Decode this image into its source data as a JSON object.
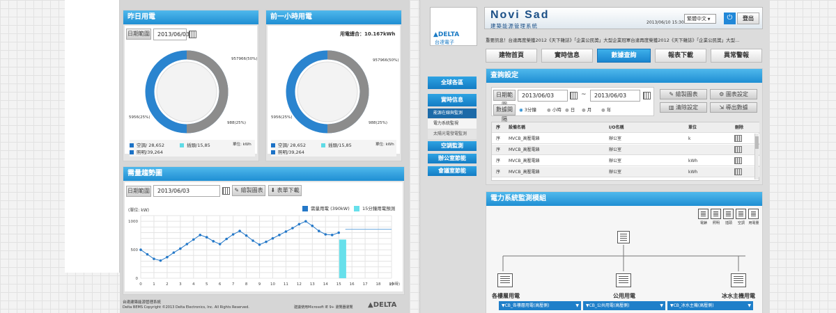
{
  "left": {
    "yesterday": {
      "title": "昨日用電",
      "date_label": "日期範圍",
      "date_value": "2013/06/03",
      "labels": {
        "top": "957966(50%)",
        "right": "988(25%)",
        "left": "5956(25%)"
      },
      "legend": [
        {
          "text": "空調/ 28,652",
          "color": "#1c72c6"
        },
        {
          "text": "插頭/15,85",
          "color": "#5fdbe6"
        },
        {
          "text": "照明/39,264",
          "color": "#1c72c6"
        }
      ],
      "unit": "單位: kWh"
    },
    "last_hour": {
      "title": "前一小時用電",
      "total": "用電總合：10.167kWh",
      "labels": {
        "top": "957966(50%)",
        "right": "988(25%)",
        "left": "5956(25%)"
      },
      "legend": [
        {
          "text": "空調/ 28,652",
          "color": "#1c72c6"
        },
        {
          "text": "插頭/15,85",
          "color": "#5fdbe6"
        },
        {
          "text": "照明/39,264",
          "color": "#1c72c6"
        }
      ],
      "unit": "單位: kWh"
    },
    "trend": {
      "title": "需量趨勢圖",
      "date_label": "日期範圍",
      "date_value": "2013/06/03",
      "draw_btn": "繪製圖表",
      "export_btn": "表單下載",
      "ylabel": "(單位: kW)",
      "legend1": "需量用電 (390kW)",
      "legend2": "15分鐘用電預測"
    },
    "footer": {
      "line1": "台達建築能源管理系統",
      "line2": "Delta BEMS Copyright ©2013 Delta Electronics, Inc. All Rights Reserved.",
      "recommend": "建議使用Microsoft IE 9+ 瀏覽器瀏覽",
      "logo": "DELTA"
    }
  },
  "chart_data": {
    "type": "line",
    "title": "需量趨勢圖",
    "xlabel": "(小時)",
    "ylabel": "(單位: kW)",
    "x_ticks": [
      "0",
      "1",
      "2",
      "3",
      "4",
      "5",
      "6",
      "7",
      "8",
      "9",
      "10",
      "11",
      "12",
      "13",
      "14",
      "15",
      "16",
      "17",
      "18",
      "19"
    ],
    "y_ticks": [
      1000,
      500,
      0
    ],
    "ylim": [
      0,
      1100
    ],
    "xlim": [
      0,
      19
    ],
    "series": [
      {
        "name": "需量用電 (390kW)",
        "color": "#2478c8",
        "x": [
          0,
          0.5,
          1,
          1.5,
          2,
          2.5,
          3,
          3.5,
          4,
          4.5,
          5,
          5.5,
          6,
          6.5,
          7,
          7.5,
          8,
          8.5,
          9,
          9.5,
          10,
          10.5,
          11,
          11.5,
          12,
          12.5,
          13,
          13.5,
          14,
          14.5,
          15
        ],
        "y": [
          500,
          420,
          340,
          310,
          370,
          450,
          520,
          600,
          680,
          760,
          720,
          650,
          600,
          690,
          770,
          830,
          750,
          660,
          590,
          640,
          700,
          760,
          820,
          880,
          950,
          1000,
          920,
          830,
          770,
          760,
          800
        ]
      },
      {
        "name": "15分鐘用電預測",
        "type": "bar",
        "color": "#67e0eb",
        "x": [
          15.3
        ],
        "y": [
          680
        ]
      }
    ],
    "grid": true
  },
  "right": {
    "logo_text": "DELTA",
    "logo_sub": "台達電子",
    "brand": "Novi Sad",
    "brand_sub": "建築能源管理系統",
    "datetime": "2013/06/10  15:30",
    "lang": "繁體中文",
    "logout": "登出",
    "news": "重要訊息！台達再度榮獲2012《天下雜誌》「企業公民獎」大型企業冠軍台達再度榮獲2012《天下雜誌》「企業公民獎」大型...",
    "tabs": [
      "建物首頁",
      "實時信息",
      "數據查詢",
      "報表下載",
      "異常警報"
    ],
    "side_nav": {
      "global": "全球各區",
      "realtime": "實時信息",
      "energy": "能源在線與監測",
      "power": "電力系統監視",
      "solar": "太陽光電發電監測",
      "ac": "空調監測",
      "office": "辦公室節能",
      "meeting": "會議室節能"
    },
    "query": {
      "title": "查詢設定",
      "date_label": "日期範圍",
      "date_from": "2013/06/03",
      "tilde": "~",
      "date_to": "2013/06/03",
      "interval_label": "數據間隔",
      "radios": [
        "3分鐘",
        "小時",
        "日",
        "月",
        "年"
      ],
      "btn_draw": "繪製圖表",
      "btn_chart_set": "圖表設定",
      "btn_clear": "清除設定",
      "btn_export": "導出數據"
    },
    "table": {
      "headers": [
        "序",
        "設備名稱",
        "I/O名稱",
        "單位",
        "刪除"
      ],
      "rows": [
        [
          "序",
          "MVCB_高壓電錶",
          "辦公室",
          "k"
        ],
        [
          "序",
          "MVCB_高壓電錶",
          "辦公室",
          ""
        ],
        [
          "序",
          "MVCB_高壓電錶",
          "辦公室",
          "kWh"
        ],
        [
          "序",
          "MVCB_高壓電錶",
          "辦公室",
          "kWh"
        ]
      ]
    },
    "monitor": {
      "title": "電力系統監測模組",
      "toolbar": [
        "電錶",
        "照明",
        "插頭",
        "空調",
        "用電量"
      ],
      "nodes": [
        "各樓層用電",
        "公用用電",
        "冰水主機用電"
      ],
      "drops": [
        "▼CB_各樓層用電(高壓側)",
        "▼CB_公共用電(高壓側)",
        "▼CB_冰水主機(高壓側)"
      ]
    }
  }
}
